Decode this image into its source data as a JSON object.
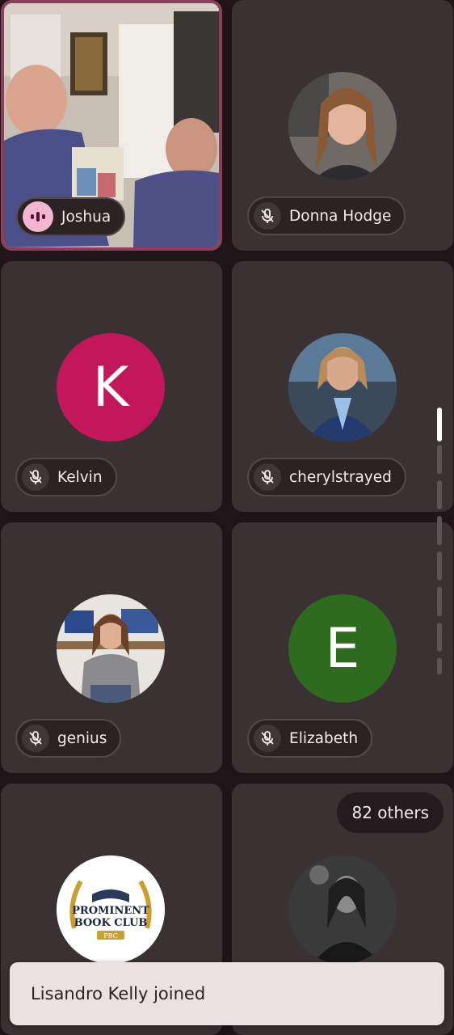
{
  "participants": [
    {
      "name": "Joshua",
      "state": "speaking"
    },
    {
      "name": "Donna Hodge",
      "state": "muted"
    },
    {
      "name": "Kelvin",
      "state": "muted",
      "initial": "K",
      "avatar_color": "#c2185b"
    },
    {
      "name": "cherylstrayed",
      "state": "muted"
    },
    {
      "name": "genius",
      "state": "muted"
    },
    {
      "name": "Elizabeth",
      "state": "muted",
      "initial": "E",
      "avatar_color": "#2e6b1f"
    }
  ],
  "bottom_tiles": {
    "club_logo": {
      "line1": "PROMINENT",
      "line2": "BOOK CLUB",
      "line3": "PBC"
    },
    "others_label": "82 others"
  },
  "toast": {
    "text": "Lisandro Kelly joined"
  },
  "colors": {
    "tile_bg": "#3a3133",
    "page_bg": "#1f1518",
    "speaking_border": "#8c3f5a"
  }
}
